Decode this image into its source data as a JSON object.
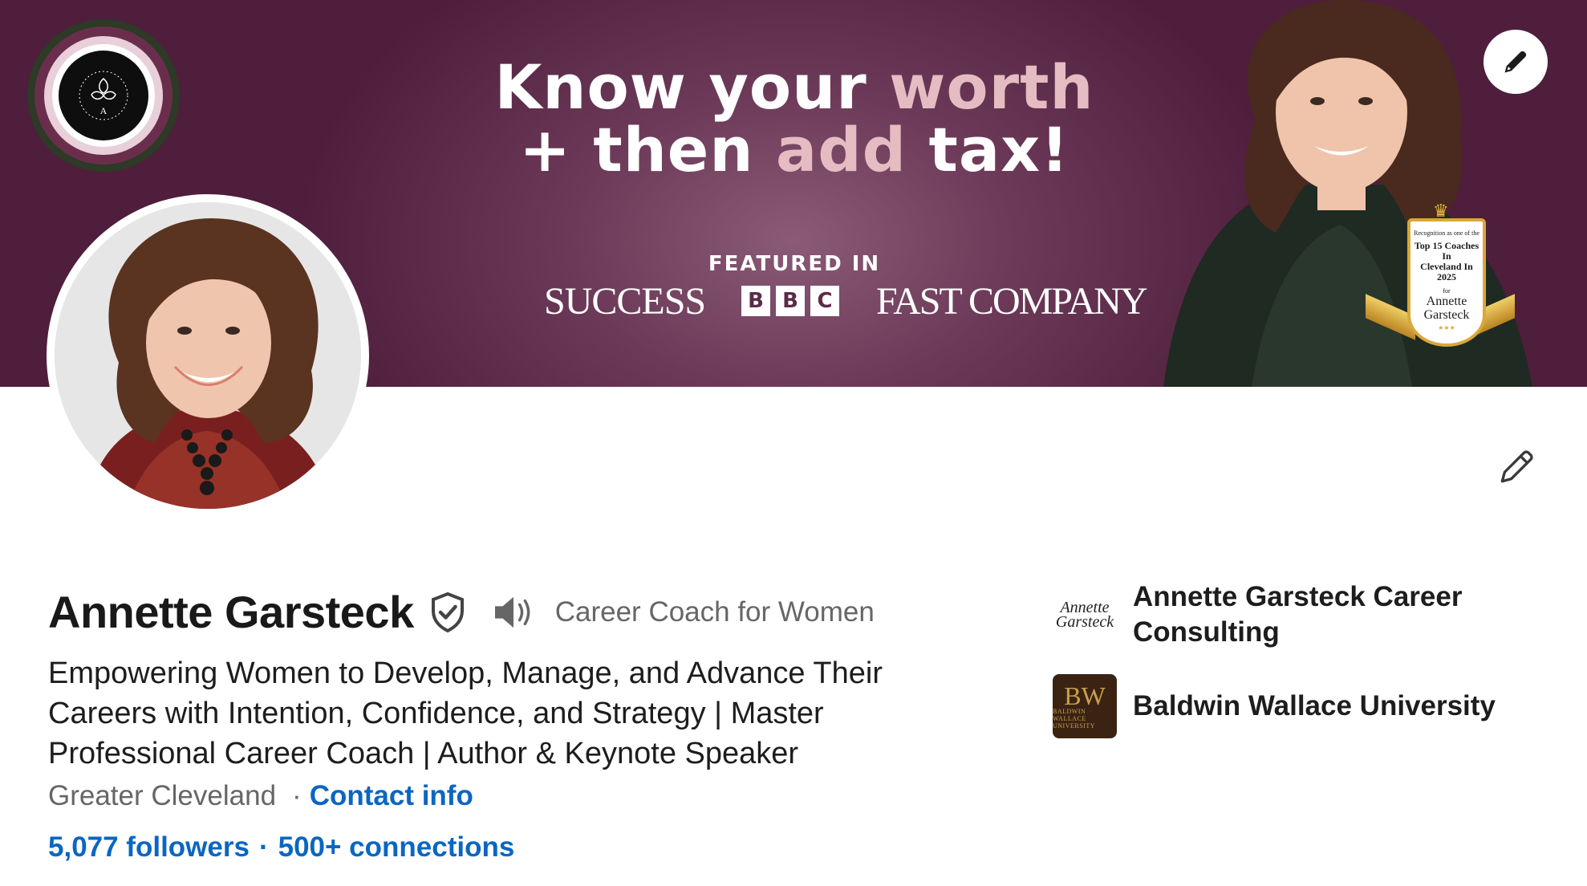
{
  "banner": {
    "headline_line1_white": "Know your",
    "headline_line1_pink": "worth",
    "headline_line2_white_a": "+ then",
    "headline_line2_pink": "add",
    "headline_line2_white_b": "tax!",
    "featured_label": "FEATURED IN",
    "brands": {
      "success": "SUCCESS",
      "bbc": [
        "B",
        "B",
        "C"
      ],
      "fast_company": "FAST COMPANY"
    },
    "badge": {
      "line1": "Recognition as one of the",
      "line2": "Top 15 Coaches In",
      "line3": "Cleveland In 2025",
      "line4": "for",
      "line5": "Annette",
      "line6": "Garsteck"
    },
    "colors": {
      "background": "#6c3a58",
      "accent_pink": "#e4bcc2",
      "badge_gold": "#d9a838"
    }
  },
  "profile": {
    "name": "Annette Garsteck",
    "short_tagline": "Career Coach for Women",
    "headline": "Empowering Women to Develop, Manage, and Advance Their Careers with Intention, Confidence, and Strategy | Master Professional Career Coach | Author & Keynote Speaker",
    "location": "Greater Cleveland",
    "location_separator": "·",
    "contact_info_label": "Contact info",
    "followers": "5,077 followers",
    "stats_separator": "·",
    "connections": "500+ connections"
  },
  "organizations": [
    {
      "name": "Annette Garsteck Career Consulting",
      "logo_text": "Annette Garsteck"
    },
    {
      "name": "Baldwin Wallace University",
      "logo_text": "BW",
      "logo_subtext": "BALDWIN WALLACE UNIVERSITY"
    }
  ],
  "icons": {
    "edit_cover": "pencil-icon",
    "edit_intro": "pencil-icon",
    "verified": "shield-check-icon",
    "pronunciation": "speaker-icon"
  },
  "colors": {
    "link_blue": "#0a66c2",
    "secondary_text": "#666666"
  }
}
